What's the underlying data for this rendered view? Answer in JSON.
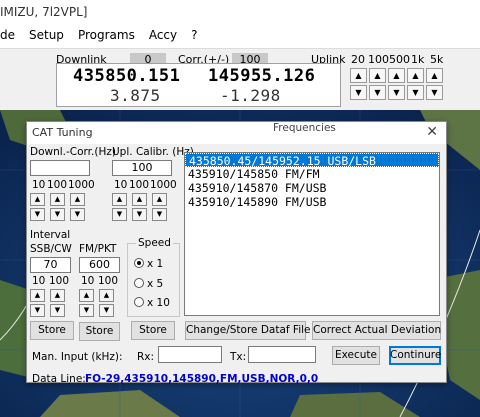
{
  "app": {
    "title_fragment": "IMIZU, 7l2VPL]",
    "menu": [
      "de",
      "Setup",
      "Programs",
      "Accy",
      "?"
    ]
  },
  "toolbar": {
    "downlink_label": "Downlink",
    "downlink_corr_value": "0",
    "corr_label": "Corr.(+/-)",
    "corr_value": "100",
    "uplink_label": "Uplink",
    "step_labels": [
      "20",
      "100",
      "500",
      "1k",
      "5k"
    ],
    "downlink_freq": "435850.151",
    "uplink_freq": "145955.126",
    "downlink_doppler": "3.875",
    "uplink_doppler": "-1.298"
  },
  "dialog": {
    "title": "CAT Tuning",
    "close_icon": "close-icon",
    "downl_corr_label": "Downl.-Corr.(Hz)",
    "downl_corr_value": "",
    "upl_calibr_label": "Upl. Calibr. (Hz)",
    "upl_calibr_value": "100",
    "step_labels": [
      "10",
      "100",
      "1000"
    ],
    "interval_label": "Interval",
    "ssb_cw_label": "SSB/CW",
    "ssb_cw_value": "70",
    "fm_pkt_label": "FM/PKT",
    "fm_pkt_value": "600",
    "interval_steps": [
      "10",
      "100"
    ],
    "speed_label": "Speed",
    "speed_options": [
      "x 1",
      "x 5",
      "x 10"
    ],
    "speed_selected": "x 1",
    "store_label": "Store",
    "frequencies_caption": "Frequencies",
    "frequency_list": [
      "435850.45/145952.15 USB/LSB",
      "435910/145850 FM/FM",
      "435910/145870 FM/USB",
      "435910/145890 FM/USB"
    ],
    "change_store_label": "Change/Store Dataf File",
    "correct_deviation_label": "Correct Actual Deviation",
    "man_input_label": "Man. Input (kHz):",
    "rx_label": "Rx:",
    "tx_label": "Tx:",
    "execute_label": "Execute",
    "continue_label": "Continure",
    "dataline_label": "Data Line:",
    "dataline_value": "FO-29,435910,145890,FM,USB,NOR,0,0"
  }
}
